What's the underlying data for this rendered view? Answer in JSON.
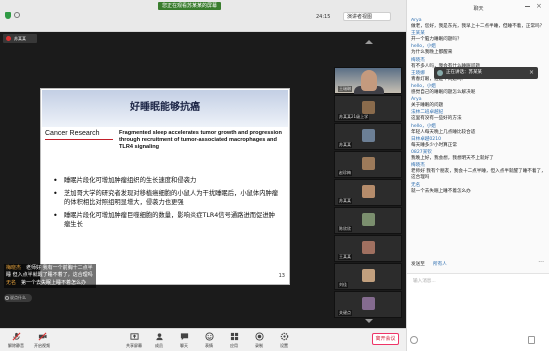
{
  "topbar": {
    "sharing_banner": "您正在观看苏某某的屏幕",
    "time": "24:15",
    "speaker_view": "演讲者视图"
  },
  "video": {
    "host_name": "苏某某",
    "slide": {
      "title": "好睡眠能够抗癌",
      "journal": "Cancer Research",
      "paper_title": "Fragmented sleep accelerates tumor growth and progression through recruitment of tumor-associated macrophages and TLR4 signaling",
      "bullets": [
        "睡眠片段化可增加肿瘤组织的生长速度和侵袭力",
        "芝加哥大学的研究者发现对移植癌细胞的小鼠人为干扰睡眠后，小鼠体内肿瘤的体积相比对照组明显增大，侵袭力也更强",
        "睡眠片段化可增加肿瘤巨噬细胞的数量，影响炎症TLR4信号通路进而促进肿瘤生长"
      ],
      "page": "13"
    },
    "chat_overlay": [
      {
        "name": "梅晓杰",
        "text": "老师好 我有一个前胸十二点半睡 但入点半就醒了睡不着了，这合理吗"
      },
      {
        "name": "无名",
        "text": "第一个去失眠上睡不着怎么办"
      }
    ],
    "chat_input_placeholder": "说点什么",
    "participants": [
      {
        "name": "王瑞琳",
        "type": "video"
      },
      {
        "name": "苏某某21级上学",
        "type": "avatar"
      },
      {
        "name": "苏某某",
        "type": "avatar"
      },
      {
        "name": "赵珍梅",
        "type": "avatar"
      },
      {
        "name": "苏某某",
        "type": "avatar"
      },
      {
        "name": "陈欣欣",
        "type": "avatar"
      },
      {
        "name": "王某某",
        "type": "avatar"
      },
      {
        "name": "刘佳",
        "type": "avatar"
      },
      {
        "name": "关键点",
        "type": "avatar"
      }
    ]
  },
  "toolbar": {
    "items": [
      {
        "label": "解除静音",
        "icon": "mic-muted-icon"
      },
      {
        "label": "开启视频",
        "icon": "video-off-icon"
      },
      {
        "label": "共享屏幕",
        "icon": "share-screen-icon"
      },
      {
        "label": "成员",
        "icon": "members-icon"
      },
      {
        "label": "聊天",
        "icon": "chat-icon"
      },
      {
        "label": "表情",
        "icon": "reaction-icon"
      },
      {
        "label": "应用",
        "icon": "apps-icon"
      },
      {
        "label": "录制",
        "icon": "record-icon"
      },
      {
        "label": "设置",
        "icon": "settings-icon"
      }
    ],
    "end_meeting": "离开会议"
  },
  "chat": {
    "title": "聊天",
    "messages": [
      {
        "name": "Arya",
        "text": "做老，您好，我是东光，我早上十二点半睡，但睡不着，正常吗？"
      },
      {
        "name": "王某某",
        "text": "开一个脑力睡眠问题吗？"
      },
      {
        "name": "hello，小姐",
        "text": "为什么我晚上都醒来"
      },
      {
        "name": "梅晓杰",
        "text": "有不多人吗，我会有什么睡眠问题"
      },
      {
        "name": "王晓娜",
        "text": "青春灯眼，这是个问题吗？"
      },
      {
        "name": "hello，小姐",
        "text": "感觉自己的睡眠问题怎么解决呢"
      },
      {
        "name": "Arya",
        "text": "关于睡眠的问题"
      },
      {
        "name": "法林二班卓越纪",
        "text": "这里有没有一些好的方法"
      },
      {
        "name": "hello，小姐",
        "text": "年轻人每天晚上几点睡比较合适"
      },
      {
        "name": "日林卓越0210",
        "text": "每天睡多少小时算正常"
      },
      {
        "name": "0827某钦",
        "text": "我晚上好，我会想，我想明天不上就好了"
      },
      {
        "name": "梅晓杰",
        "text": "老师好 我有个朋友，我会十二点半睡，但入点半就醒了睡不着了，这合理吗"
      },
      {
        "name": "无名",
        "text": "就一个去失眠上睡不着怎么办"
      }
    ],
    "hover_toast": "正在讲话：苏某某",
    "send_to_label": "发送至",
    "send_to_target": "所有人",
    "input_placeholder": "输入消息..."
  }
}
